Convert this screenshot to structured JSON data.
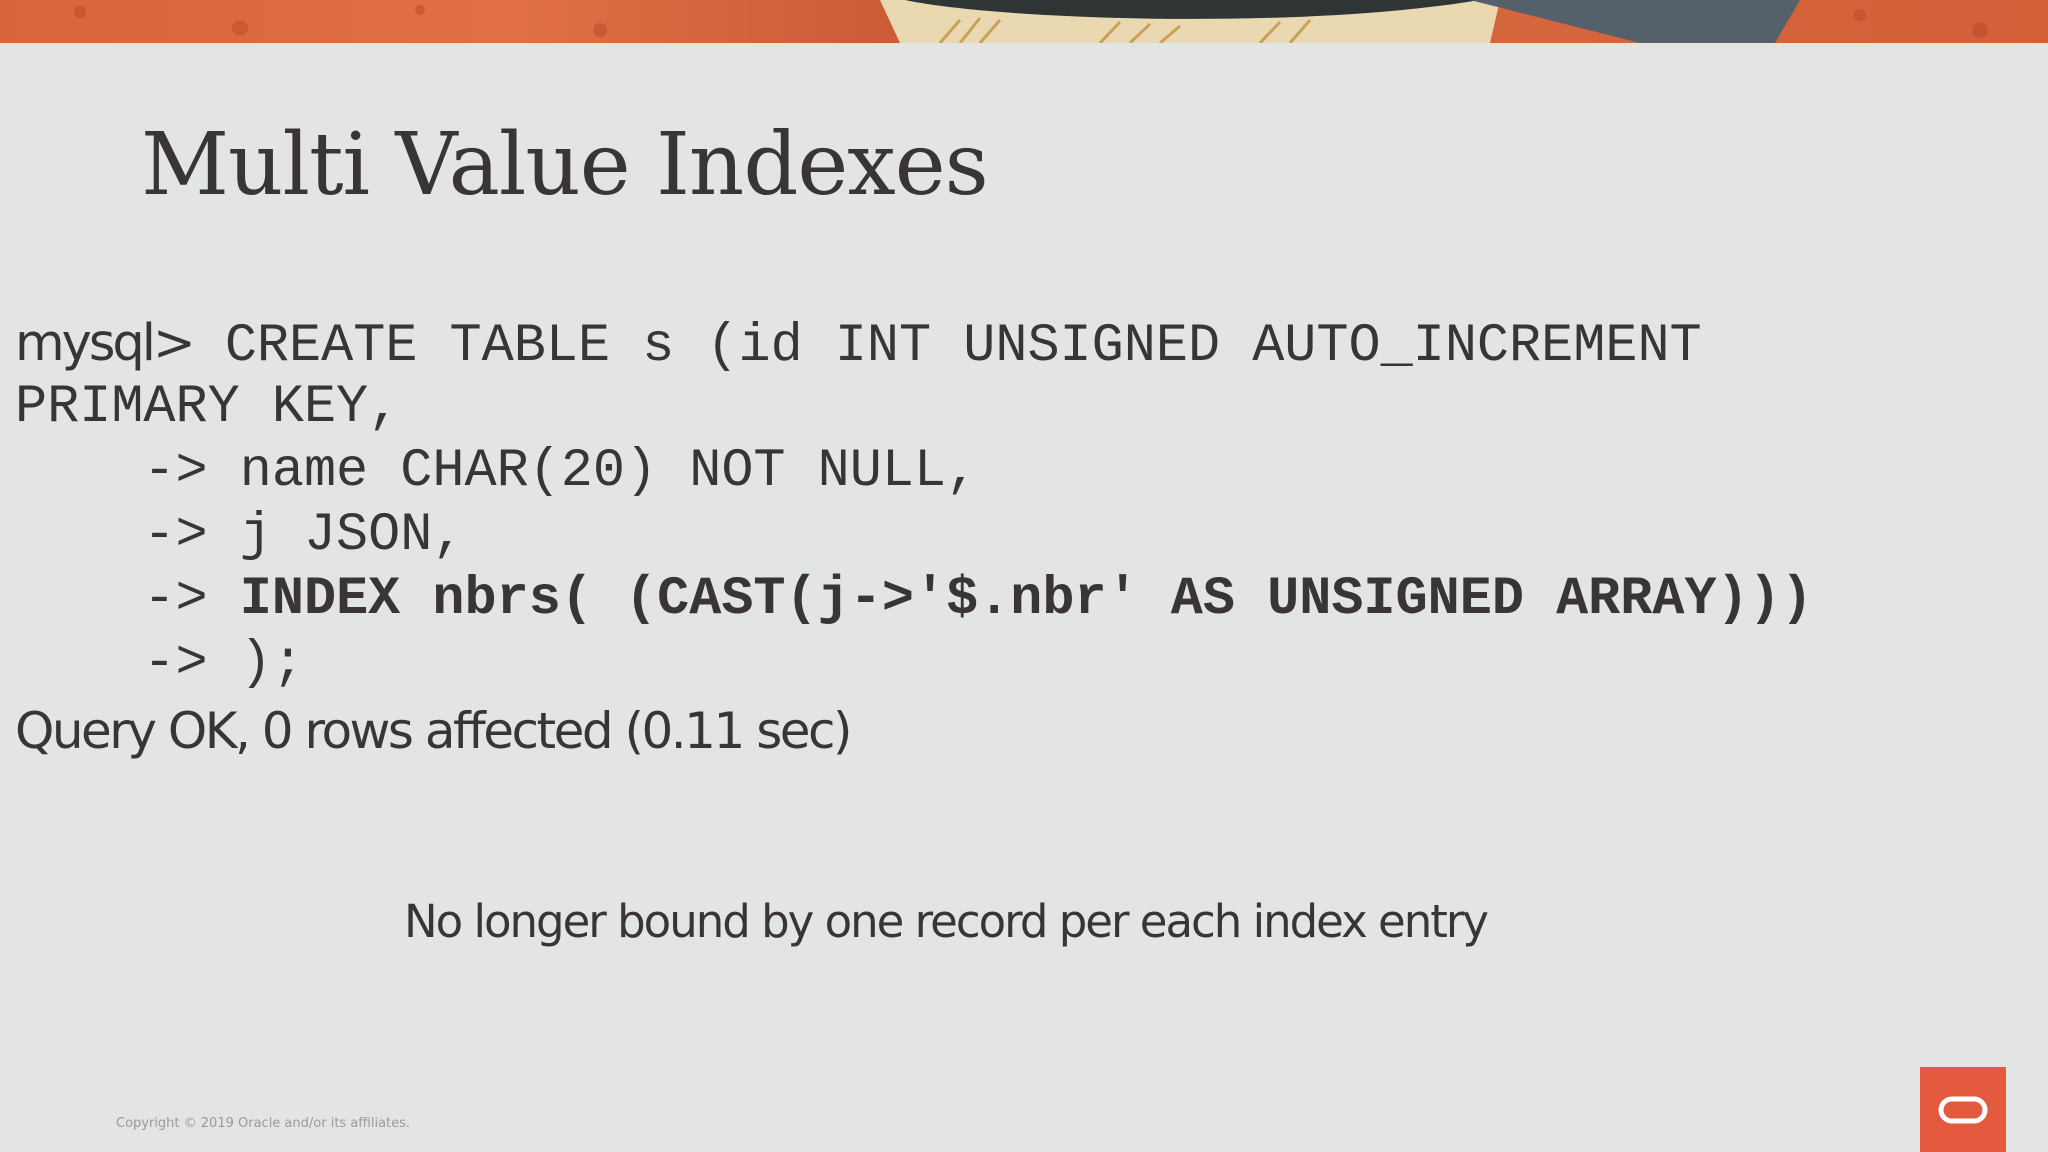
{
  "slide": {
    "title": "Multi Value Indexes",
    "code": {
      "prompt": "mysql>",
      "lines": [
        " CREATE TABLE s (id INT UNSIGNED AUTO_INCREMENT",
        "PRIMARY KEY,",
        "    -> name CHAR(20) NOT NULL,",
        "    -> j JSON,",
        "    -> ",
        "INDEX nbrs( (CAST(j->'$.nbr' AS UNSIGNED ARRAY)))",
        "    -> );"
      ]
    },
    "result": "Query OK, 0 rows affected (0.11 sec)",
    "subtext": "No longer bound by one record per each index entry",
    "copyright": "Copyright © 2019 Oracle and/or its affiliates."
  },
  "colors": {
    "background": "#e3e4e4",
    "text": "#3a3535",
    "accent": "#e35a3e",
    "banner": "#d9653a"
  },
  "icons": {
    "logo": "oracle-logo-icon"
  }
}
